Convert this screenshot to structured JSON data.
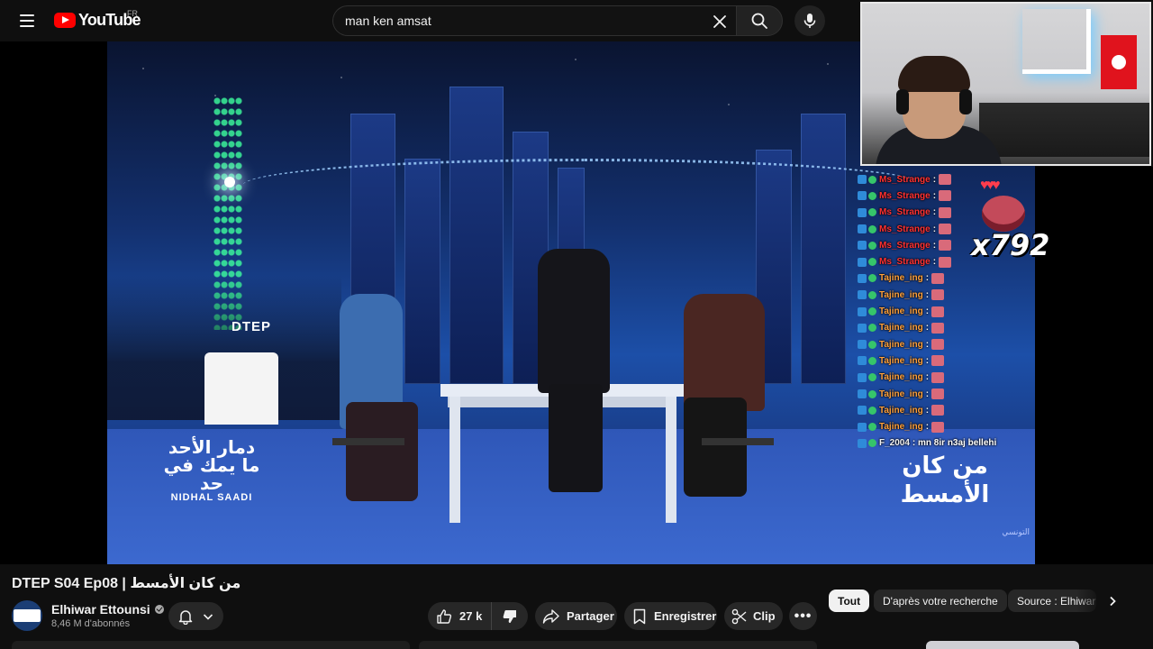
{
  "header": {
    "logo_text": "YouTube",
    "region": "FR",
    "search": {
      "value": "man ken amsat"
    }
  },
  "video": {
    "overlay": {
      "dtep_badge": "DTEP",
      "left_watermark": "دمار الأحد ما يمك في حد",
      "left_watermark_sub": "NIDHAL SAADI",
      "right_title": "من كان الأمسط",
      "channel_bug": "التونسي"
    },
    "webcam": {
      "label": "streamer webcam"
    },
    "chat": [
      {
        "user": "Ms_Strange",
        "color": "red",
        "msg": ":"
      },
      {
        "user": "Ms_Strange",
        "color": "red",
        "msg": ":"
      },
      {
        "user": "Ms_Strange",
        "color": "red",
        "msg": ":"
      },
      {
        "user": "Ms_Strange",
        "color": "red",
        "msg": ":"
      },
      {
        "user": "Ms_Strange",
        "color": "red",
        "msg": ":"
      },
      {
        "user": "Ms_Strange",
        "color": "red",
        "msg": ":"
      },
      {
        "user": "Tajine_ing",
        "color": "orange",
        "msg": ":"
      },
      {
        "user": "Tajine_ing",
        "color": "orange",
        "msg": ":"
      },
      {
        "user": "Tajine_ing",
        "color": "orange",
        "msg": ":"
      },
      {
        "user": "Tajine_ing",
        "color": "orange",
        "msg": ":"
      },
      {
        "user": "Tajine_ing",
        "color": "orange",
        "msg": ":"
      },
      {
        "user": "Tajine_ing",
        "color": "orange",
        "msg": ":"
      },
      {
        "user": "Tajine_ing",
        "color": "orange",
        "msg": ":"
      },
      {
        "user": "Tajine_ing",
        "color": "orange",
        "msg": ":"
      },
      {
        "user": "Tajine_ing",
        "color": "orange",
        "msg": ":"
      },
      {
        "user": "Tajine_ing",
        "color": "orange",
        "msg": ":"
      },
      {
        "user": "F_2004",
        "color": "white",
        "msg": ": mn 8ir n3aj bellehi"
      }
    ],
    "combo": {
      "count": "x792"
    }
  },
  "details": {
    "title": "DTEP S04 Ep08 | من كان الأمسط",
    "channel": {
      "name": "Elhiwar Ettounsi",
      "subscribers": "8,46 M d'abonnés"
    },
    "actions": {
      "likes": "27 k",
      "share": "Partager",
      "save": "Enregistrer",
      "clip": "Clip",
      "more": "•••"
    }
  },
  "chips": [
    {
      "label": "Tout",
      "active": true
    },
    {
      "label": "D'après votre recherche",
      "active": false
    },
    {
      "label": "Source : Elhiwar Ettounsi",
      "active": false
    }
  ],
  "colors": {
    "background": "#0f0f0f",
    "brand_red": "#ff0000",
    "pill_bg": "#272727",
    "chat_red": "#ff3030",
    "chat_orange": "#ffa03a"
  },
  "icons": [
    "menu-icon",
    "youtube-logo-icon",
    "clear-icon",
    "search-icon",
    "mic-icon",
    "bell-icon",
    "chevron-down-icon",
    "like-icon",
    "dislike-icon",
    "share-icon",
    "save-icon",
    "clip-icon",
    "more-icon",
    "chevron-right-icon",
    "verified-icon"
  ]
}
